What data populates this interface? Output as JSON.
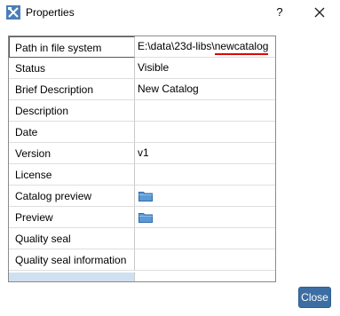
{
  "window": {
    "title": "Properties",
    "help_label": "?",
    "close_icon": "close-icon",
    "app_icon": "properties-tool-icon"
  },
  "properties": [
    {
      "label": "Path in file system",
      "value_prefix": "E:\\data\\23d-libs\\",
      "value_highlight": "newcatalog",
      "highlight_color": "#e00000"
    },
    {
      "label": "Status",
      "value": "Visible"
    },
    {
      "label": "Brief Description",
      "value": "New Catalog"
    },
    {
      "label": "Description",
      "value": ""
    },
    {
      "label": "Date",
      "value": ""
    },
    {
      "label": "Version",
      "value": "v1"
    },
    {
      "label": "License",
      "value": ""
    },
    {
      "label": "Catalog preview",
      "icon": "folder-icon"
    },
    {
      "label": "Preview",
      "icon": "folder-icon"
    },
    {
      "label": "Quality seal",
      "value": ""
    },
    {
      "label": "Quality seal information",
      "value": ""
    }
  ],
  "buttons": {
    "close_label": "Close"
  },
  "colors": {
    "accent": "#3d6ea3",
    "selection": "#cfe0f0",
    "highlight_underline": "#e00000"
  }
}
